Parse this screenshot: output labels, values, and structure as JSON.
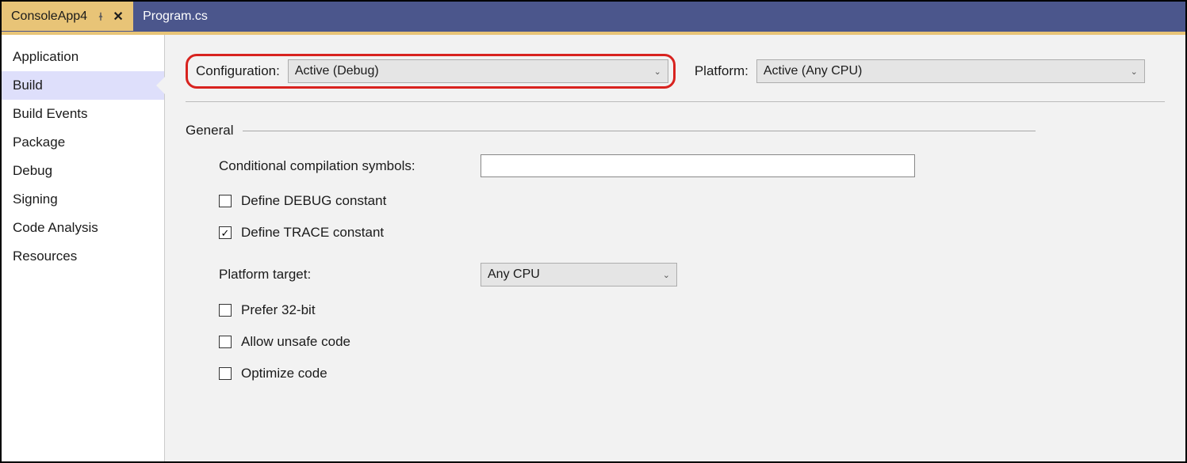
{
  "tabs": {
    "active": {
      "label": "ConsoleApp4"
    },
    "inactive": {
      "label": "Program.cs"
    }
  },
  "sidebar": {
    "items": [
      {
        "label": "Application"
      },
      {
        "label": "Build"
      },
      {
        "label": "Build Events"
      },
      {
        "label": "Package"
      },
      {
        "label": "Debug"
      },
      {
        "label": "Signing"
      },
      {
        "label": "Code Analysis"
      },
      {
        "label": "Resources"
      }
    ]
  },
  "toolbar": {
    "configuration_label": "Configuration:",
    "configuration_value": "Active (Debug)",
    "platform_label": "Platform:",
    "platform_value": "Active (Any CPU)"
  },
  "section": {
    "general": "General"
  },
  "form": {
    "conditional_symbols_label": "Conditional compilation symbols:",
    "conditional_symbols_value": "",
    "define_debug": "Define DEBUG constant",
    "define_trace": "Define TRACE constant",
    "platform_target_label": "Platform target:",
    "platform_target_value": "Any CPU",
    "prefer_32bit": "Prefer 32-bit",
    "allow_unsafe": "Allow unsafe code",
    "optimize_code": "Optimize code"
  }
}
